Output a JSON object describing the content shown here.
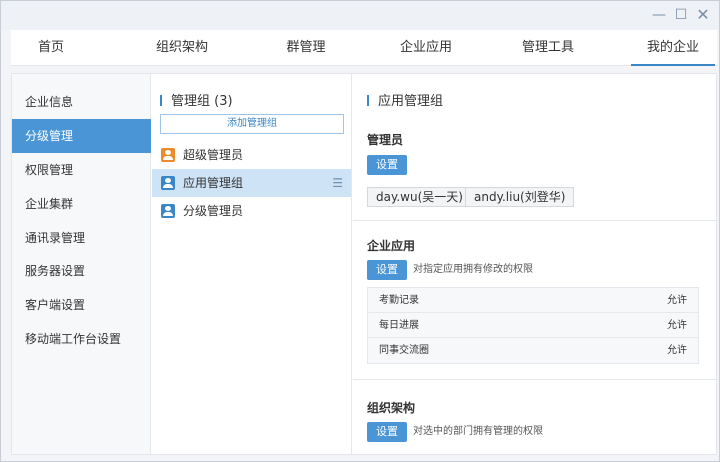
{
  "window": {
    "minimize_glyph": "—",
    "maximize_glyph": "☐",
    "close_glyph": "✕"
  },
  "nav": {
    "tabs": [
      {
        "label": "首页"
      },
      {
        "label": "组织架构"
      },
      {
        "label": "群管理"
      },
      {
        "label": "企业应用"
      },
      {
        "label": "管理工具"
      },
      {
        "label": "我的企业"
      }
    ],
    "active_index": 5
  },
  "sidebar": {
    "items": [
      {
        "label": "企业信息"
      },
      {
        "label": "分级管理"
      },
      {
        "label": "权限管理"
      },
      {
        "label": "企业集群"
      },
      {
        "label": "通讯录管理"
      },
      {
        "label": "服务器设置"
      },
      {
        "label": "客户端设置"
      },
      {
        "label": "移动端工作台设置"
      }
    ],
    "active_index": 1
  },
  "groups": {
    "title": "管理组 (3)",
    "add_label": "添加管理组",
    "items": [
      {
        "label": "超级管理员",
        "icon": "admin-user-icon"
      },
      {
        "label": "应用管理组",
        "icon": "group-user-icon"
      },
      {
        "label": "分级管理员",
        "icon": "group-user-icon"
      }
    ],
    "active_index": 1,
    "menu_glyph": "☰"
  },
  "detail": {
    "title": "应用管理组",
    "admins": {
      "title": "管理员",
      "set_label": "设置",
      "users": [
        "day.wu(吴一天)",
        "andy.liu(刘登华)"
      ]
    },
    "apps": {
      "title": "企业应用",
      "set_label": "设置",
      "hint": "对指定应用拥有修改的权限",
      "rows": [
        {
          "name": "考勤记录",
          "perm": "允许"
        },
        {
          "name": "每日进展",
          "perm": "允许"
        },
        {
          "name": "同事交流圈",
          "perm": "允许"
        }
      ]
    },
    "org": {
      "title": "组织架构",
      "set_label": "设置",
      "hint": "对选中的部门拥有管理的权限"
    }
  },
  "colors": {
    "accent": "#4a95d6",
    "active_row": "#cfe3f6",
    "orange_icon": "#ed8a2a"
  }
}
